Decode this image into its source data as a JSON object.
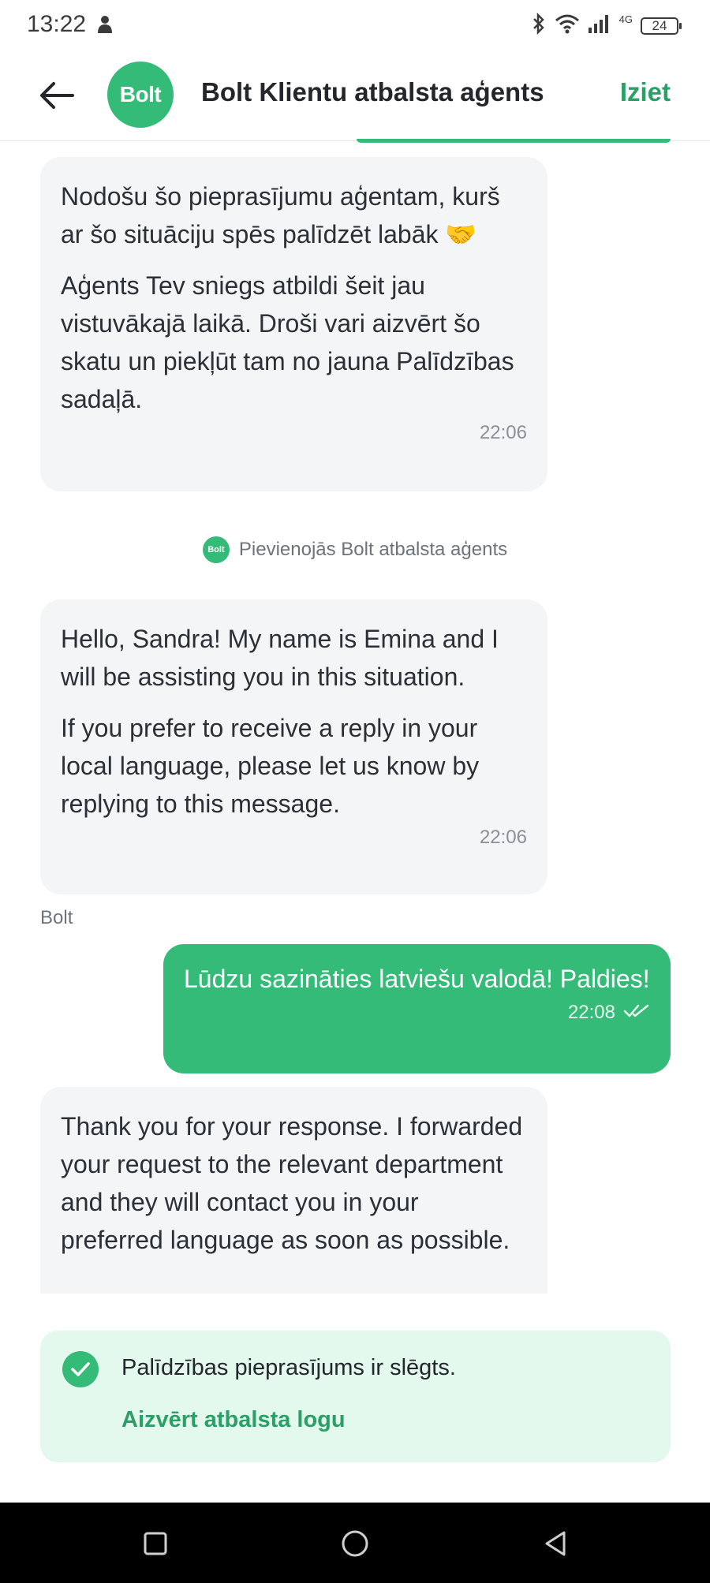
{
  "status": {
    "time": "13:22",
    "network": "4G",
    "battery": "24"
  },
  "header": {
    "avatar_text": "Bolt",
    "title": "Bolt Klientu atbalsta aģents",
    "exit_label": "Iziet"
  },
  "messages": {
    "m1": {
      "p1": "Nodošu šo pieprasījumu aģentam, kurš ar šo situāciju spēs palīdzēt labāk 🤝",
      "p2": "Aģents Tev sniegs atbildi šeit jau vistuvākajā laikā. Droši vari aizvērt šo skatu un piekļūt tam no jauna Palīdzības sadaļā.",
      "time": "22:06"
    },
    "system_note": {
      "logo_text": "Bolt",
      "text": "Pievienojās Bolt atbalsta aģents"
    },
    "m2": {
      "p1": "Hello, Sandra! My name is Emina and I will be assisting you in this situation.",
      "p2": "If you prefer to receive a reply in your local language, please let us know by replying to this message.",
      "time": "22:06",
      "sender": "Bolt"
    },
    "m3": {
      "text": "Lūdzu sazināties latviešu valodā! Paldies!",
      "time": "22:08"
    },
    "m4": {
      "text": "Thank you for your response. I forwarded your request to the relevant department and they will contact you in your preferred language as soon as possible."
    }
  },
  "closed_banner": {
    "text": "Palīdzības pieprasījums ir slēgts.",
    "link": "Aizvērt atbalsta logu"
  },
  "colors": {
    "brand_green": "#34bb78",
    "link_green": "#2a9f66",
    "bubble_gray": "#f3f5f7",
    "banner_bg": "#e3f9ee"
  },
  "icons": [
    "back-arrow-icon",
    "check-icon",
    "read-receipt-icon",
    "square-nav-icon",
    "circle-nav-icon",
    "triangle-nav-icon"
  ]
}
